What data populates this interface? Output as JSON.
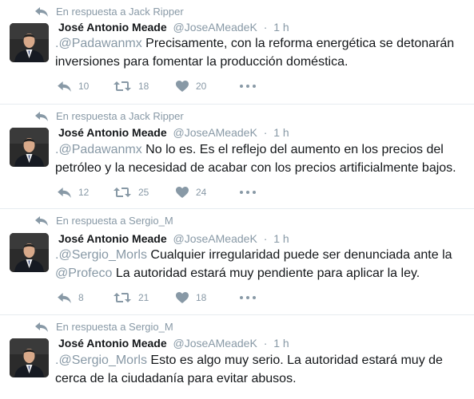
{
  "tweets": [
    {
      "reply_context": "En respuesta a Jack Ripper",
      "author_name": "José Antonio Meade",
      "handle": "@JoseAMeadeK",
      "time": "1 h",
      "mention1": ".@Padawanmx",
      "text_after_mention1": " Precisamente, con la reforma energética se detonarán inversiones para fomentar la producción doméstica.",
      "mention2": "",
      "text_after_mention2": "",
      "replies": "10",
      "retweets": "18",
      "likes": "20"
    },
    {
      "reply_context": "En respuesta a Jack Ripper",
      "author_name": "José Antonio Meade",
      "handle": "@JoseAMeadeK",
      "time": "1 h",
      "mention1": ".@Padawanmx",
      "text_after_mention1": " No lo es. Es el reflejo del aumento en los precios del petróleo y la necesidad de acabar con los precios artificialmente bajos.",
      "mention2": "",
      "text_after_mention2": "",
      "replies": "12",
      "retweets": "25",
      "likes": "24"
    },
    {
      "reply_context": "En respuesta a Sergio_M",
      "author_name": "José Antonio Meade",
      "handle": "@JoseAMeadeK",
      "time": "1 h",
      "mention1": ".@Sergio_Morls",
      "text_after_mention1": " Cualquier irregularidad puede ser denunciada ante la ",
      "mention2": "@Profeco",
      "text_after_mention2": " La autoridad estará muy pendiente para aplicar la ley.",
      "replies": "8",
      "retweets": "21",
      "likes": "18"
    },
    {
      "reply_context": "En respuesta a Sergio_M",
      "author_name": "José Antonio Meade",
      "handle": "@JoseAMeadeK",
      "time": "1 h",
      "mention1": ".@Sergio_Morls",
      "text_after_mention1": " Esto es algo muy serio. La autoridad estará muy de cerca de la ciudadanía para evitar abusos.",
      "mention2": "",
      "text_after_mention2": "",
      "replies": "",
      "retweets": "",
      "likes": ""
    }
  ],
  "colors": {
    "text": "#14171a",
    "muted": "#8899a6",
    "divider": "#e6ecf0"
  },
  "icons": [
    "reply-arrow-icon",
    "reply-icon",
    "retweet-icon",
    "like-icon",
    "more-icon"
  ]
}
